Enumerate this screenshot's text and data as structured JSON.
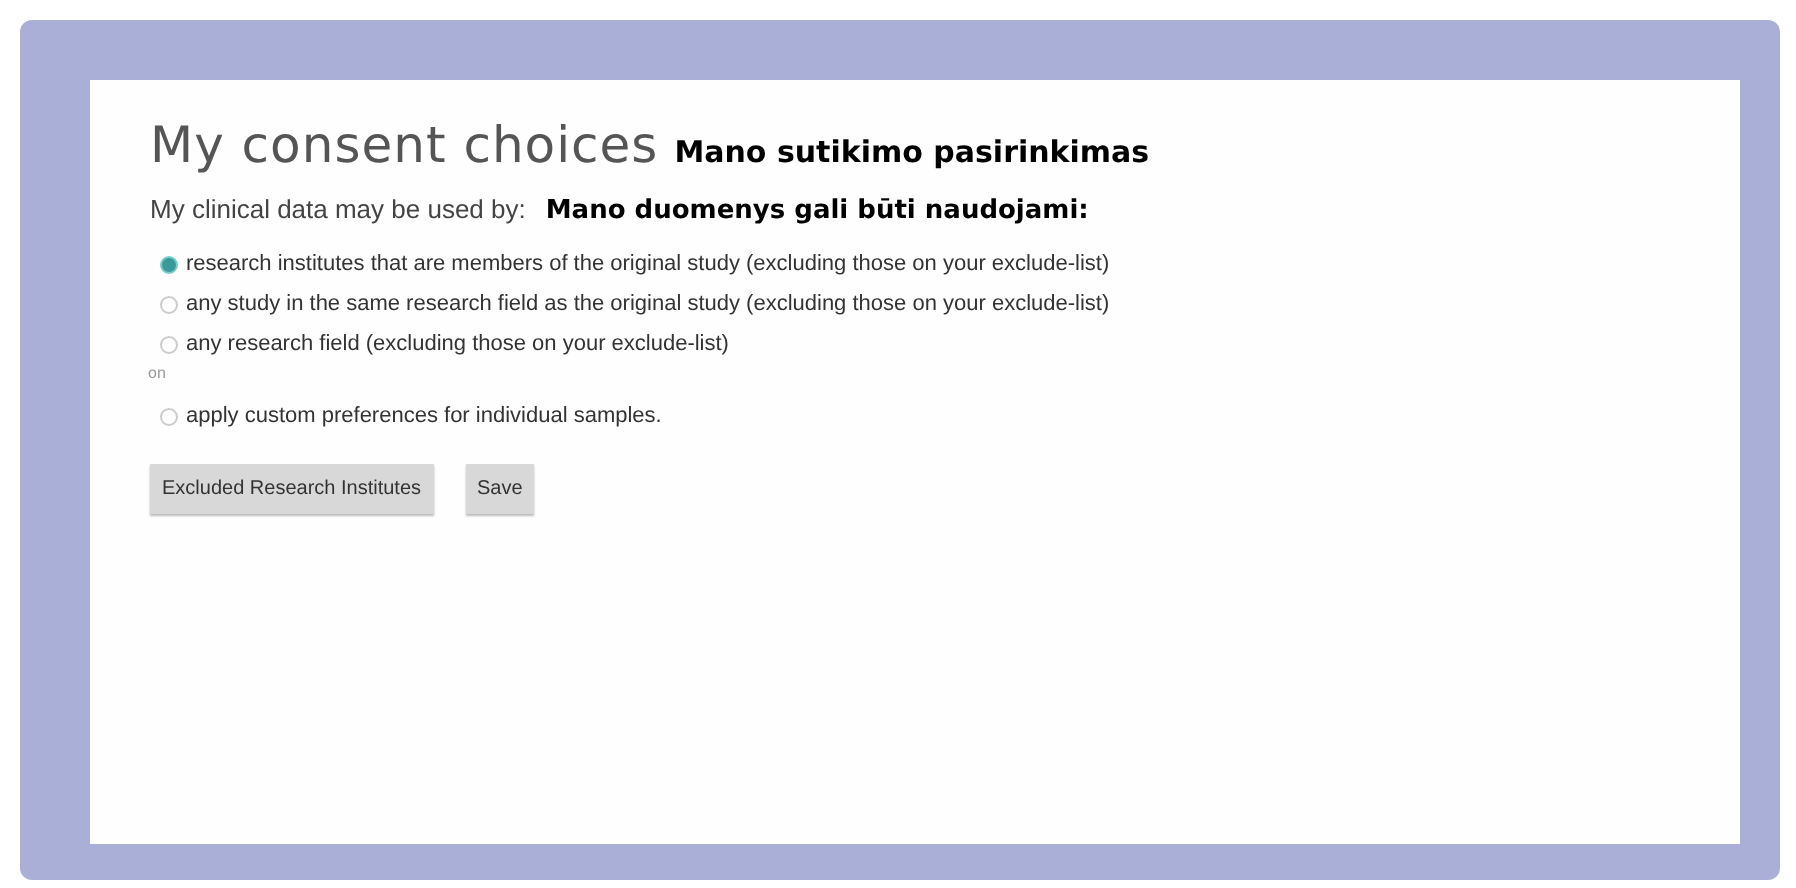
{
  "heading": {
    "title": "My consent choices",
    "translation": "Mano sutikimo pasirinkimas"
  },
  "prompt": {
    "text": "My clinical data may be used by:",
    "translation": "Mano duomenys gali būti naudojami:"
  },
  "options": [
    {
      "label": "research institutes that are members of the original study (excluding those on your exclude-list)",
      "selected": true
    },
    {
      "label": "any study in the same research field as the original study (excluding those on your exclude-list)",
      "selected": false
    },
    {
      "label": "any research field (excluding those on your exclude-list)",
      "selected": false
    },
    {
      "label": "apply custom preferences for individual samples.",
      "selected": false
    }
  ],
  "separator": "on",
  "buttons": [
    "Excluded Research Institutes",
    "Save"
  ]
}
